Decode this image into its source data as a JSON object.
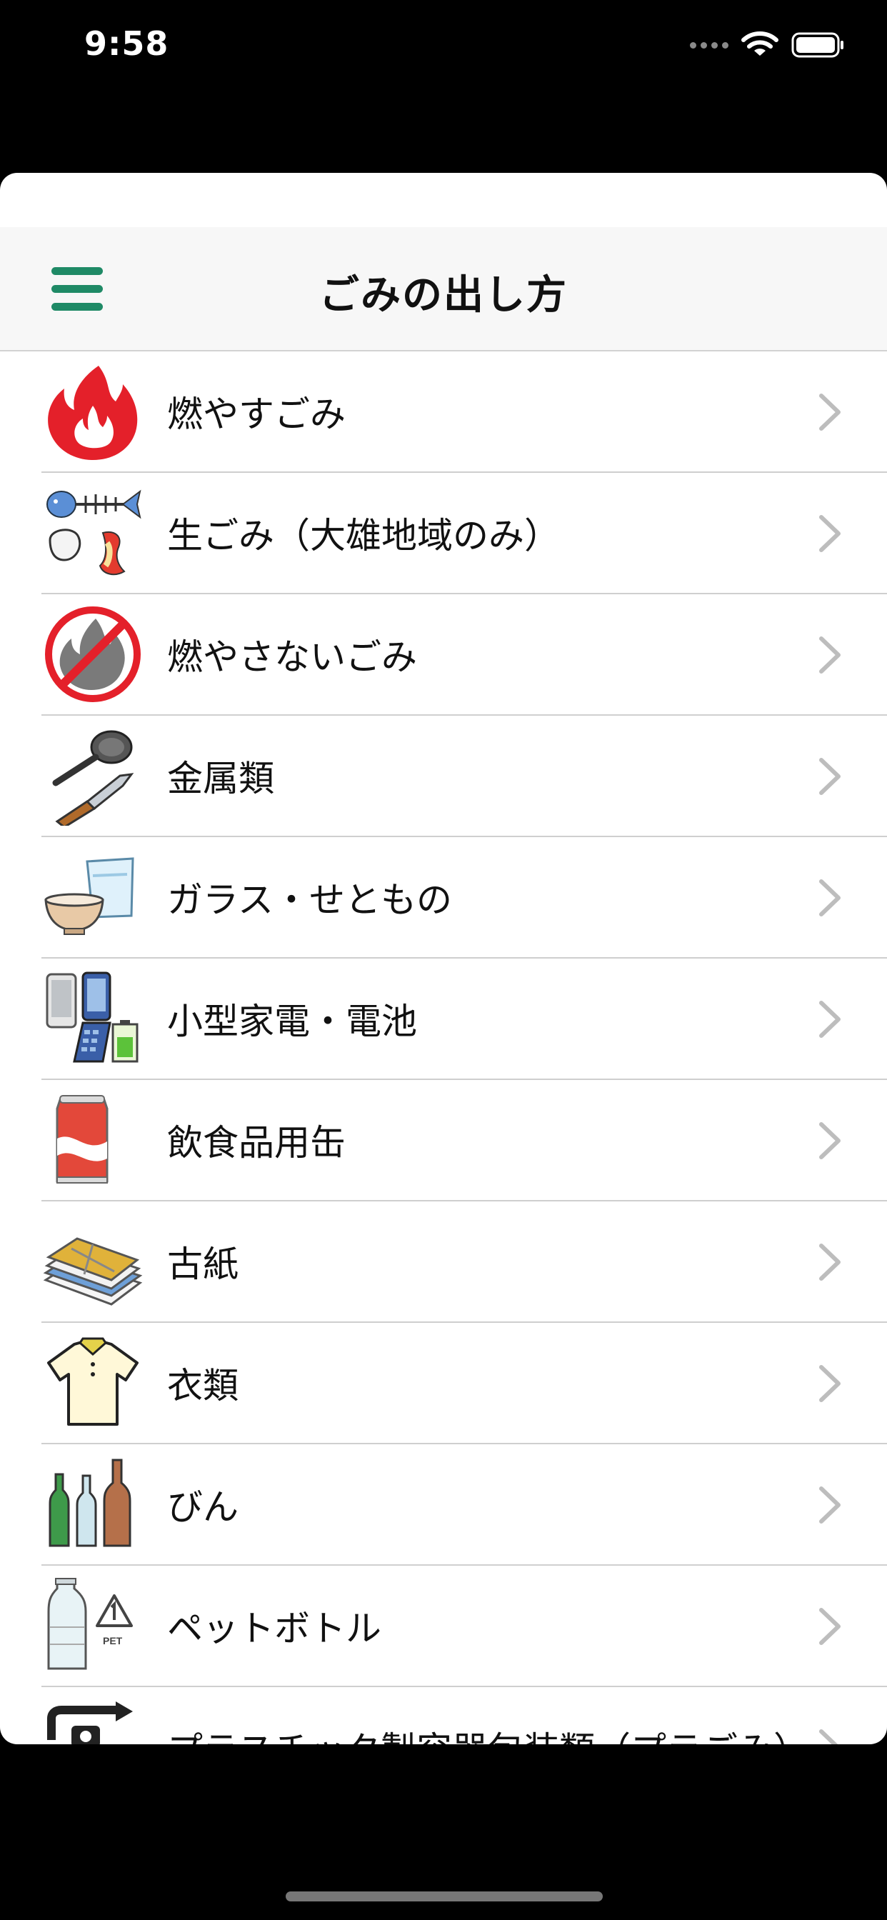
{
  "status_bar": {
    "time": "9:58"
  },
  "header": {
    "title": "ごみの出し方"
  },
  "items": [
    {
      "label": "燃やすごみ",
      "icon": "fire-icon"
    },
    {
      "label": "生ごみ（大雄地域のみ）",
      "icon": "food-waste-icon"
    },
    {
      "label": "燃やさないごみ",
      "icon": "no-burn-icon"
    },
    {
      "label": "金属類",
      "icon": "metal-icon"
    },
    {
      "label": "ガラス・せともの",
      "icon": "glass-pottery-icon"
    },
    {
      "label": "小型家電・電池",
      "icon": "small-appliance-icon"
    },
    {
      "label": "飲食品用缶",
      "icon": "can-icon"
    },
    {
      "label": "古紙",
      "icon": "paper-icon"
    },
    {
      "label": "衣類",
      "icon": "clothing-icon"
    },
    {
      "label": "びん",
      "icon": "bottle-icon"
    },
    {
      "label": "ペットボトル",
      "icon": "pet-bottle-icon"
    },
    {
      "label": "プラスチック製容器包装類（プラごみ）",
      "icon": "plastic-icon"
    }
  ],
  "colors": {
    "accent": "#1f8a66",
    "separator": "#cfcfcf",
    "nav_background": "#f7f7f7"
  }
}
